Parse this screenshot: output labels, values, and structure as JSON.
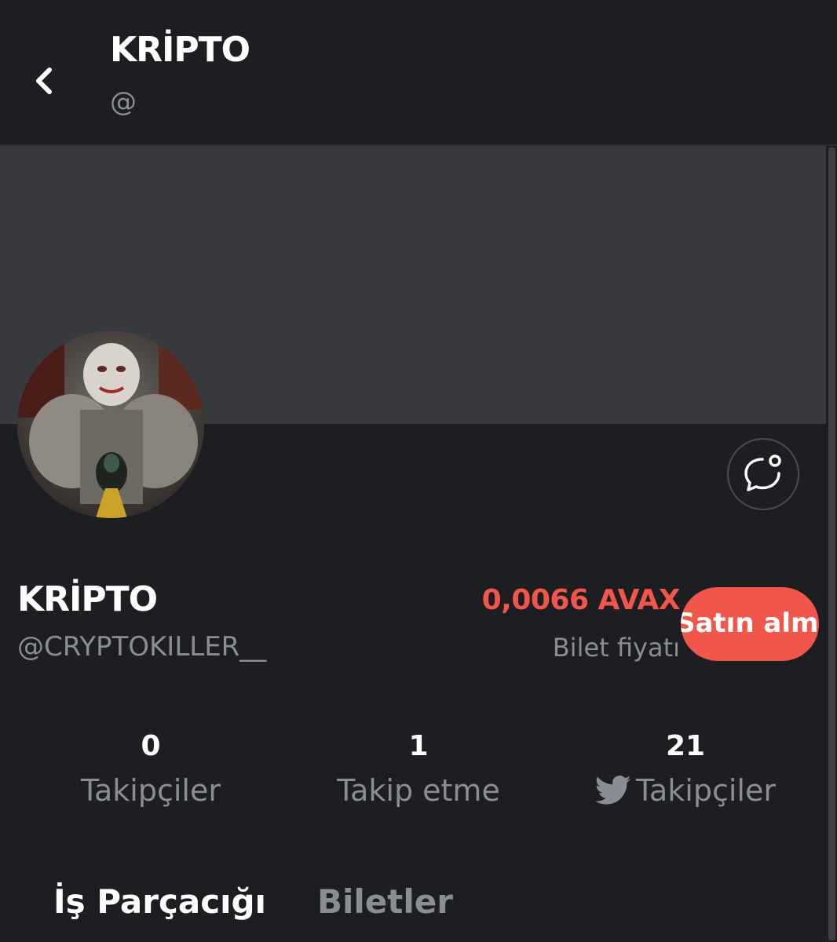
{
  "header": {
    "title": "KRİPTO",
    "subtitle": "@",
    "back_icon": "chevron-left-icon"
  },
  "profile": {
    "name": "KRİPTO",
    "handle": "@CRYPTOKILLER__",
    "chat_icon": "chat-bubble-icon",
    "ticket_price": "0,0066 AVAX",
    "ticket_price_label": "Bilet fiyatı",
    "buy_label": "Satın almak"
  },
  "stats": [
    {
      "value": "0",
      "label": "Takipçiler"
    },
    {
      "value": "1",
      "label": "Takip etme"
    },
    {
      "value": "21",
      "label": "Takipçiler",
      "icon": "twitter-bird-icon"
    }
  ],
  "tabs": [
    {
      "label": "İş Parçacığı",
      "active": true
    },
    {
      "label": "Biletler",
      "active": false
    }
  ],
  "colors": {
    "background": "#1d1e21",
    "banner": "#393a3e",
    "accent": "#f1564a",
    "muted_text": "#8a8d93"
  }
}
